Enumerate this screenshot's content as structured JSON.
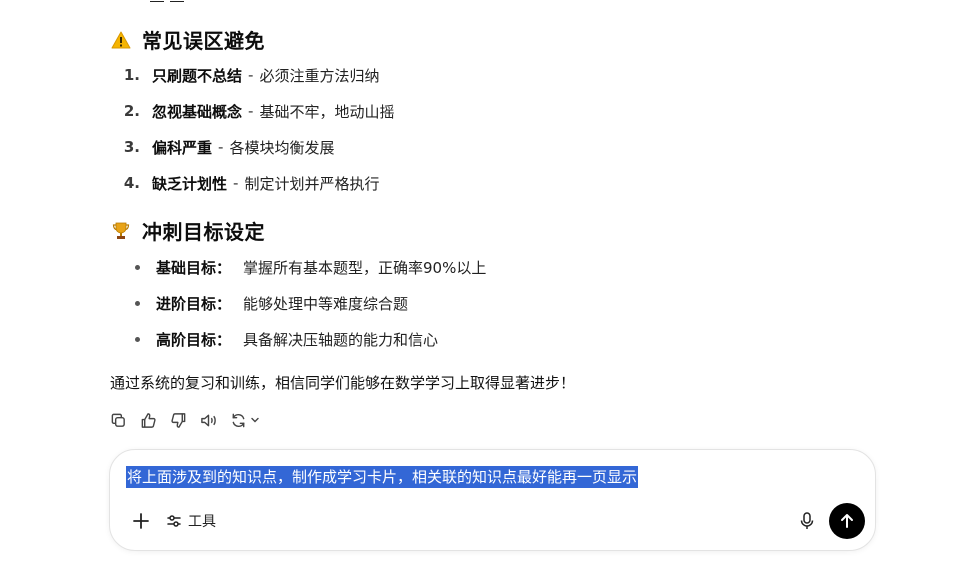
{
  "sections": {
    "pitfalls": {
      "emoji": "warning-icon",
      "title": "常见误区避免",
      "items": [
        {
          "num": "1.",
          "label": "只刷题不总结",
          "sep": "-",
          "desc": "必须注重方法归纳"
        },
        {
          "num": "2.",
          "label": "忽视基础概念",
          "sep": "-",
          "desc": "基础不牢，地动山摇"
        },
        {
          "num": "3.",
          "label": "偏科严重",
          "sep": "-",
          "desc": "各模块均衡发展"
        },
        {
          "num": "4.",
          "label": "缺乏计划性",
          "sep": "-",
          "desc": "制定计划并严格执行"
        }
      ]
    },
    "goals": {
      "emoji": "trophy-icon",
      "title": "冲刺目标设定",
      "items": [
        {
          "label": "基础目标：",
          "desc": "掌握所有基本题型，正确率90%以上"
        },
        {
          "label": "进阶目标：",
          "desc": "能够处理中等难度综合题"
        },
        {
          "label": "高阶目标：",
          "desc": "具备解决压轴题的能力和信心"
        }
      ]
    }
  },
  "summary": "通过系统的复习和训练，相信同学们能够在数学学习上取得显著进步！",
  "actions": [
    "copy-icon",
    "thumbs-up-icon",
    "thumbs-down-icon",
    "read-aloud-icon",
    "regenerate-icon"
  ],
  "composer": {
    "text": "将上面涉及到的知识点，制作成学习卡片，相关联的知识点最好能再一页显示",
    "plus_label": "+",
    "tools_label": "工具"
  },
  "colors": {
    "selection": "#3367d6",
    "send_button": "#000000"
  }
}
